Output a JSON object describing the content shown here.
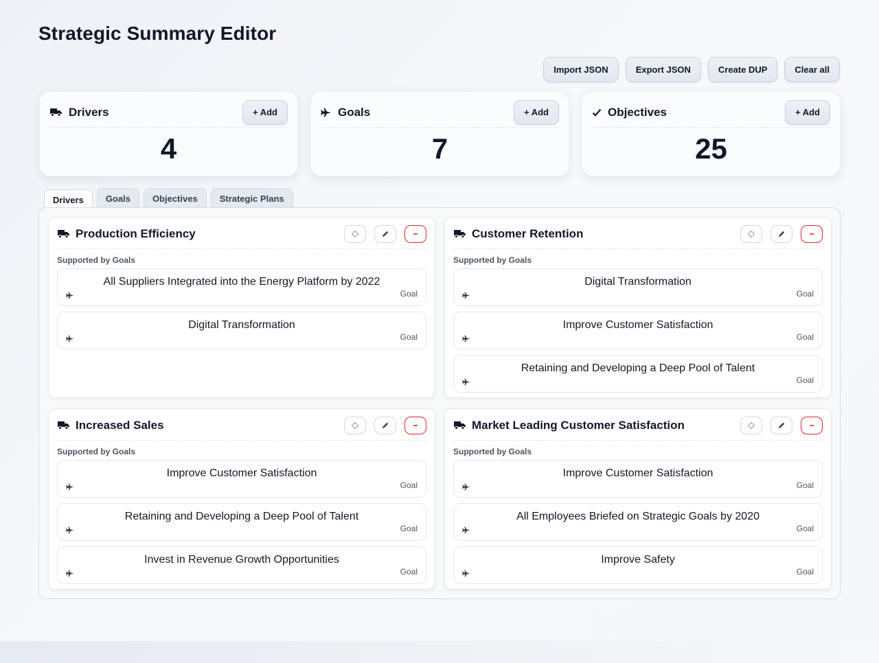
{
  "title": "Strategic Summary Editor",
  "toolbar": {
    "buttons": [
      "Import JSON",
      "Export JSON",
      "Create DUP",
      "Clear all"
    ]
  },
  "stats": [
    {
      "label": "Drivers",
      "value": "4",
      "add_label": "+ Add",
      "icon": "truck-icon"
    },
    {
      "label": "Goals",
      "value": "7",
      "add_label": "+ Add",
      "icon": "plane-icon"
    },
    {
      "label": "Objectives",
      "value": "25",
      "add_label": "+ Add",
      "icon": "check-icon"
    }
  ],
  "tabs": [
    "Drivers",
    "Goals",
    "Objectives",
    "Strategic Plans"
  ],
  "active_tab": "Drivers",
  "drivers": [
    {
      "name": "Production Efficiency",
      "section_label": "Supported by Goals",
      "goals": [
        {
          "name": "All Suppliers Integrated into the Energy Platform by 2022",
          "type": "Goal"
        },
        {
          "name": "Digital Transformation",
          "type": "Goal"
        }
      ]
    },
    {
      "name": "Customer Retention",
      "section_label": "Supported by Goals",
      "goals": [
        {
          "name": "Digital Transformation",
          "type": "Goal"
        },
        {
          "name": "Improve Customer Satisfaction",
          "type": "Goal"
        },
        {
          "name": "Retaining and Developing a Deep Pool of Talent",
          "type": "Goal"
        }
      ]
    },
    {
      "name": "Increased Sales",
      "section_label": "Supported by Goals",
      "goals": [
        {
          "name": "Improve Customer Satisfaction",
          "type": "Goal"
        },
        {
          "name": "Retaining and Developing a Deep Pool of Talent",
          "type": "Goal"
        },
        {
          "name": "Invest in Revenue Growth Opportunities",
          "type": "Goal"
        }
      ]
    },
    {
      "name": "Market Leading Customer Satisfaction",
      "section_label": "Supported by Goals",
      "goals": [
        {
          "name": "Improve Customer Satisfaction",
          "type": "Goal"
        },
        {
          "name": "All Employees Briefed on Strategic Goals by 2020",
          "type": "Goal"
        },
        {
          "name": "Improve Safety",
          "type": "Goal"
        }
      ]
    }
  ],
  "icons": {
    "target": "target-icon",
    "edit": "pencil-icon",
    "remove": "minus-icon"
  },
  "colors": {
    "danger": "#dc2626",
    "text": "#111827"
  }
}
